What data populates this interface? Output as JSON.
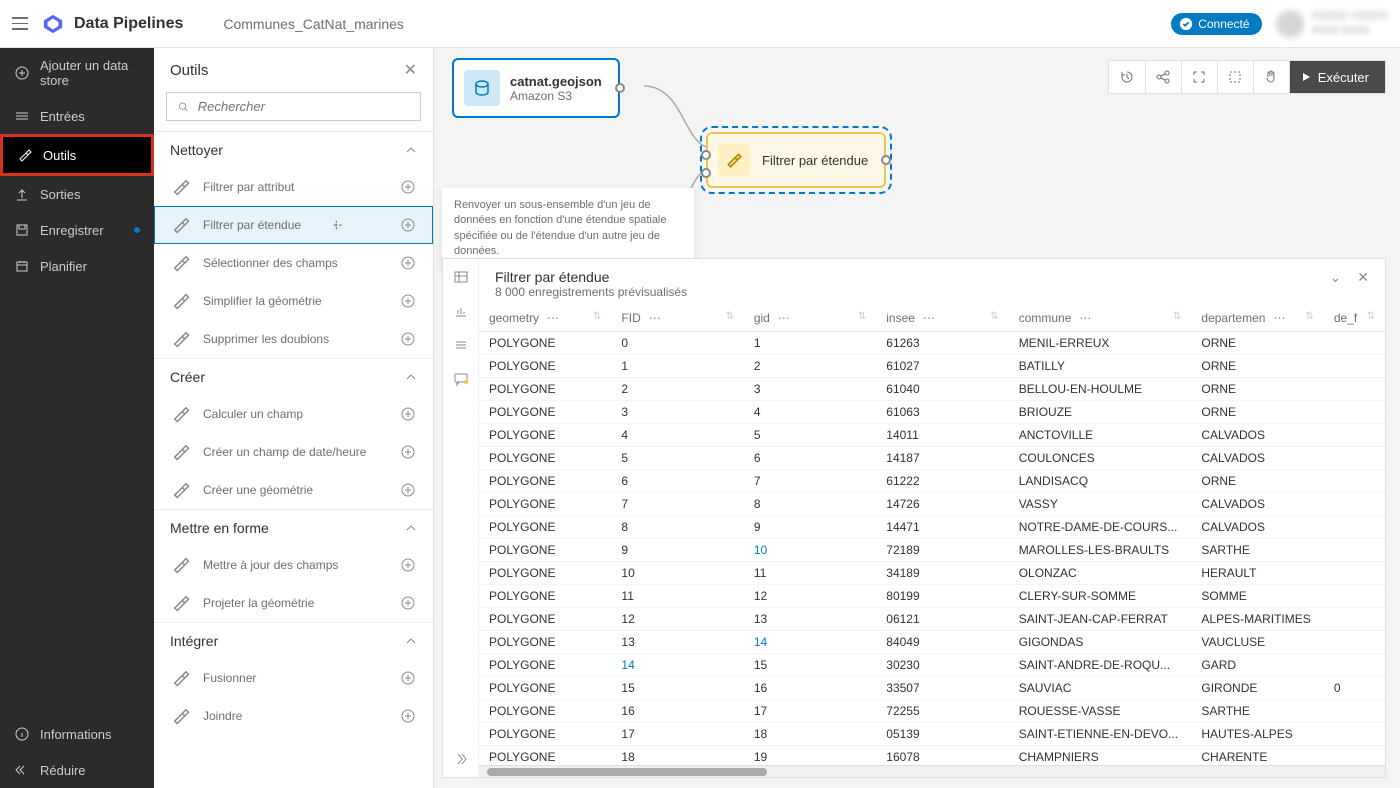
{
  "header": {
    "app_title": "Data Pipelines",
    "pipeline_name": "Communes_CatNat_marines",
    "connected": "Connecté",
    "user_line1": "XXXXX XXXXX",
    "user_line2": "xxxxx xxxxx"
  },
  "sidebar": {
    "add_datastore": "Ajouter un data store",
    "inputs": "Entrées",
    "tools": "Outils",
    "outputs": "Sorties",
    "save": "Enregistrer",
    "schedule": "Planifier",
    "info": "Informations",
    "collapse": "Réduire"
  },
  "tools_panel": {
    "title": "Outils",
    "search_placeholder": "Rechercher",
    "sections": {
      "clean": "Nettoyer",
      "create": "Créer",
      "format": "Mettre en forme",
      "integrate": "Intégrer"
    },
    "items": {
      "filter_attr": "Filtrer par attribut",
      "filter_extent": "Filtrer par étendue",
      "select_fields": "Sélectionner des champs",
      "simplify_geom": "Simplifier la géométrie",
      "remove_dup": "Supprimer les doublons",
      "calc_field": "Calculer un champ",
      "create_datetime": "Créer un champ de date/heure",
      "create_geom": "Créer une géométrie",
      "update_fields": "Mettre à jour des champs",
      "project_geom": "Projeter la géométrie",
      "merge": "Fusionner",
      "join": "Joindre"
    },
    "tooltip": "Renvoyer un sous-ensemble d'un jeu de données en fonction d'une étendue spatiale spécifiée ou de l'étendue d'un autre jeu de données."
  },
  "canvas": {
    "input_node": {
      "title": "catnat.geojson",
      "subtitle": "Amazon S3"
    },
    "filter_node": {
      "title": "Filtrer par étendue"
    },
    "execute": "Exécuter"
  },
  "preview": {
    "title": "Filtrer par étendue",
    "subtitle": "8 000 enregistrements prévisualisés",
    "columns": [
      "geometry",
      "FID",
      "gid",
      "insee",
      "commune",
      "departemen",
      "de_f"
    ],
    "rows": [
      [
        "POLYGONE",
        "0",
        "1",
        "61263",
        "MENIL-ERREUX",
        "ORNE",
        ""
      ],
      [
        "POLYGONE",
        "1",
        "2",
        "61027",
        "BATILLY",
        "ORNE",
        ""
      ],
      [
        "POLYGONE",
        "2",
        "3",
        "61040",
        "BELLOU-EN-HOULME",
        "ORNE",
        ""
      ],
      [
        "POLYGONE",
        "3",
        "4",
        "61063",
        "BRIOUZE",
        "ORNE",
        ""
      ],
      [
        "POLYGONE",
        "4",
        "5",
        "14011",
        "ANCTOVILLE",
        "CALVADOS",
        ""
      ],
      [
        "POLYGONE",
        "5",
        "6",
        "14187",
        "COULONCES",
        "CALVADOS",
        ""
      ],
      [
        "POLYGONE",
        "6",
        "7",
        "61222",
        "LANDISACQ",
        "ORNE",
        ""
      ],
      [
        "POLYGONE",
        "7",
        "8",
        "14726",
        "VASSY",
        "CALVADOS",
        ""
      ],
      [
        "POLYGONE",
        "8",
        "9",
        "14471",
        "NOTRE-DAME-DE-COURS...",
        "CALVADOS",
        ""
      ],
      [
        "POLYGONE",
        "9",
        "10",
        "72189",
        "MAROLLES-LES-BRAULTS",
        "SARTHE",
        ""
      ],
      [
        "POLYGONE",
        "10",
        "11",
        "34189",
        "OLONZAC",
        "HERAULT",
        ""
      ],
      [
        "POLYGONE",
        "11",
        "12",
        "80199",
        "CLERY-SUR-SOMME",
        "SOMME",
        ""
      ],
      [
        "POLYGONE",
        "12",
        "13",
        "06121",
        "SAINT-JEAN-CAP-FERRAT",
        "ALPES-MARITIMES",
        ""
      ],
      [
        "POLYGONE",
        "13",
        "14",
        "84049",
        "GIGONDAS",
        "VAUCLUSE",
        ""
      ],
      [
        "POLYGONE",
        "14",
        "15",
        "30230",
        "SAINT-ANDRE-DE-ROQU...",
        "GARD",
        ""
      ],
      [
        "POLYGONE",
        "15",
        "16",
        "33507",
        "SAUVIAC",
        "GIRONDE",
        "0"
      ],
      [
        "POLYGONE",
        "16",
        "17",
        "72255",
        "ROUESSE-VASSE",
        "SARTHE",
        ""
      ],
      [
        "POLYGONE",
        "17",
        "18",
        "05139",
        "SAINT-ETIENNE-EN-DEVO...",
        "HAUTES-ALPES",
        ""
      ],
      [
        "POLYGONE",
        "18",
        "19",
        "16078",
        "CHAMPNIERS",
        "CHARENTE",
        ""
      ]
    ]
  }
}
